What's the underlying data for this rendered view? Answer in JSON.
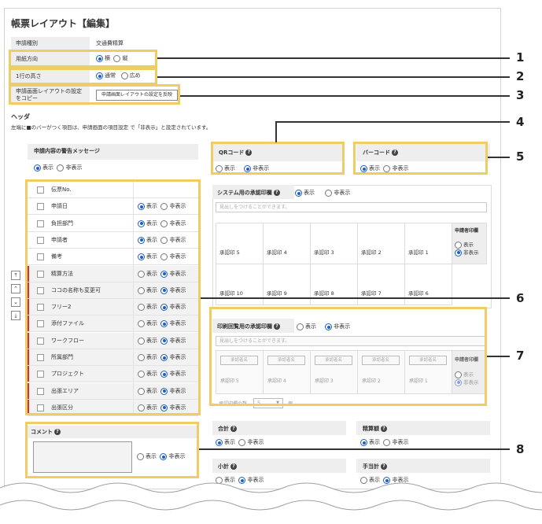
{
  "title": "帳票レイアウト【編集】",
  "form": {
    "type_label": "申請種別",
    "type_value": "交通費精算",
    "orientation_label": "用紙方向",
    "orientation_opts": [
      "横",
      "縦"
    ],
    "rowheight_label": "1行の高さ",
    "rowheight_opts": [
      "通常",
      "広め"
    ],
    "copy_label": "申請画面レイアウトの設定をコピー",
    "copy_button": "申請画面レイアウトの設定を反映"
  },
  "header_title": "ヘッダ",
  "note": "左端に■のバーがつく項目は、申請画面の項目設定 で「非表示」と設定されています。",
  "show": "表示",
  "hide": "非表示",
  "msg_title": "申請内容の警告メッセージ",
  "qr_title": "QRコード",
  "barcode_title": "バーコード",
  "fields": [
    {
      "label": "伝票No.",
      "hidden": false,
      "sel": null
    },
    {
      "label": "申請日",
      "hidden": false,
      "sel": "show"
    },
    {
      "label": "負担部門",
      "hidden": false,
      "sel": "show"
    },
    {
      "label": "申請者",
      "hidden": false,
      "sel": "show"
    },
    {
      "label": "備考",
      "hidden": false,
      "sel": "show"
    },
    {
      "label": "精算方法",
      "hidden": true,
      "sel": "hide"
    },
    {
      "label": "ココの名称も変更可",
      "hidden": true,
      "sel": "hide"
    },
    {
      "label": "フリー2",
      "hidden": true,
      "sel": "hide"
    },
    {
      "label": "添付ファイル",
      "hidden": true,
      "sel": "hide"
    },
    {
      "label": "ワークフロー",
      "hidden": true,
      "sel": "hide"
    },
    {
      "label": "所属部門",
      "hidden": true,
      "sel": "hide"
    },
    {
      "label": "プロジェクト",
      "hidden": true,
      "sel": "hide"
    },
    {
      "label": "出張エリア",
      "hidden": true,
      "sel": "hide"
    },
    {
      "label": "出張区分",
      "hidden": true,
      "sel": "hide"
    }
  ],
  "sys_stamp": {
    "title": "システム用の承認印欄",
    "placeholder": "見出しをつけることができます。",
    "row1": [
      "承認印 5",
      "承認印 4",
      "承認印 3",
      "承認印 2",
      "承認印 1"
    ],
    "row2": [
      "承認印 10",
      "承認印 9",
      "承認印 8",
      "承認印 7",
      "承認印 6"
    ],
    "applicant": "申請者印欄"
  },
  "print_stamp": {
    "title": "印刷回覧用の承認印欄",
    "placeholder": "見出しをつけることができます。",
    "names": [
      "承認者名",
      "承認者名",
      "承認者名",
      "承認者名",
      "承認者名"
    ],
    "row": [
      "承認印 5",
      "承認印 4",
      "承認印 3",
      "承認印 2",
      "承認印 1"
    ],
    "applicant": "申請者印欄",
    "count_label": "承認印欄の数",
    "count_value": "5",
    "count_unit": "個"
  },
  "comment_title": "コメント",
  "total": "合計",
  "settle": "精算額",
  "subtotal": "小計",
  "allowance": "手当計",
  "callouts": [
    "1",
    "2",
    "3",
    "4",
    "5",
    "6",
    "7",
    "8"
  ]
}
